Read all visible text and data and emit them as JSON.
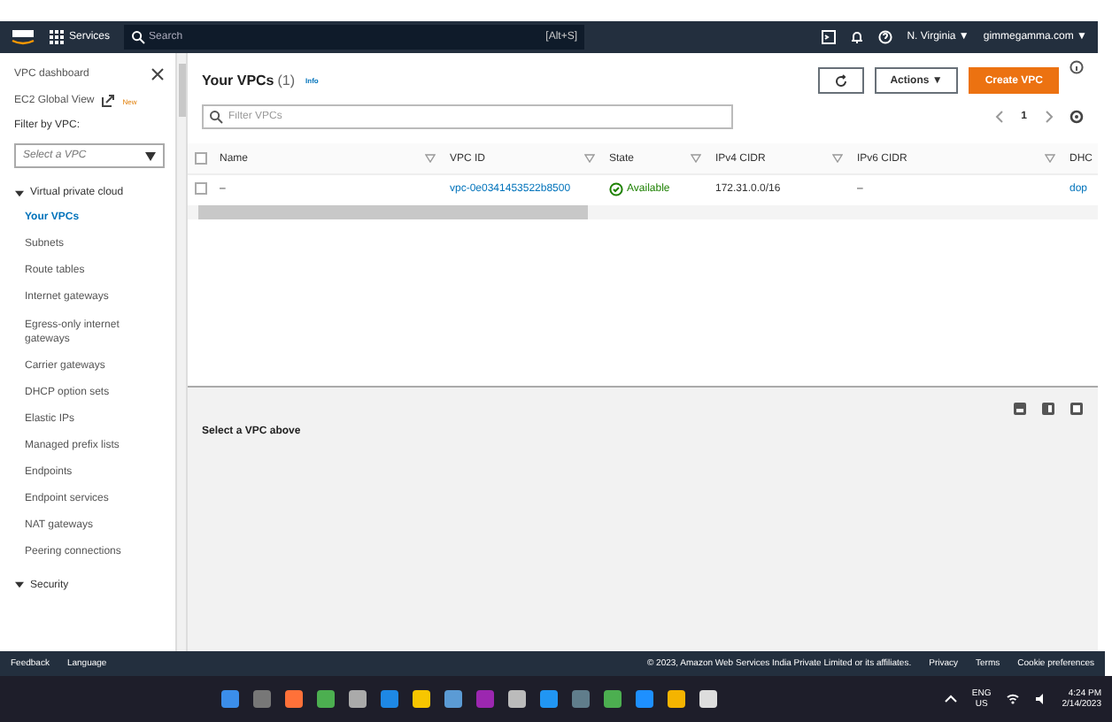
{
  "topnav": {
    "services": "Services",
    "search_placeholder": "Search",
    "shortcut": "[Alt+S]",
    "region": "N. Virginia ▼",
    "account": "gimmegamma.com ▼"
  },
  "sidebar": {
    "dashboard": "VPC dashboard",
    "ec2": "EC2 Global View",
    "new_badge": "New",
    "filter_label": "Filter by VPC:",
    "filter_placeholder": "Select a VPC",
    "sections": [
      {
        "title": "Virtual private cloud",
        "expanded": true,
        "items": [
          {
            "label": "Your VPCs",
            "selected": true
          },
          {
            "label": "Subnets",
            "selected": false
          },
          {
            "label": "Route tables",
            "selected": false
          },
          {
            "label": "Internet gateways",
            "selected": false
          },
          {
            "label": "Egress-only internet gateways",
            "selected": false
          },
          {
            "label": "Carrier gateways",
            "selected": false
          },
          {
            "label": "DHCP option sets",
            "selected": false
          },
          {
            "label": "Elastic IPs",
            "selected": false
          },
          {
            "label": "Managed prefix lists",
            "selected": false
          },
          {
            "label": "Endpoints",
            "selected": false
          },
          {
            "label": "Endpoint services",
            "selected": false
          },
          {
            "label": "NAT gateways",
            "selected": false
          },
          {
            "label": "Peering connections",
            "selected": false
          }
        ]
      },
      {
        "title": "Security",
        "expanded": true
      }
    ]
  },
  "main": {
    "title": "Your VPCs",
    "count": "(1)",
    "info": "Info",
    "actions": "Actions ▼",
    "create": "Create VPC",
    "filter_placeholder": "Filter VPCs",
    "page": "1",
    "select_all": {
      "checked": false
    },
    "columns": [
      "Name",
      "VPC ID",
      "State",
      "IPv4 CIDR",
      "IPv6 CIDR",
      "DHC"
    ],
    "rows": [
      {
        "selected": false,
        "cells": [
          "–",
          "vpc-0e0341453522b8500",
          "Available",
          "172.31.0.0/16",
          "–",
          "dop"
        ]
      }
    ],
    "detail": "Select a VPC above"
  },
  "footer": {
    "left": [
      "Feedback",
      "Language"
    ],
    "copyright": "© 2023, Amazon Web Services India Private Limited or its affiliates.",
    "links": [
      "Privacy",
      "Terms",
      "Cookie preferences"
    ]
  },
  "taskbar": {
    "lang": "ENG",
    "region": "US",
    "time": "4:24 PM",
    "date": "2/14/2023"
  }
}
